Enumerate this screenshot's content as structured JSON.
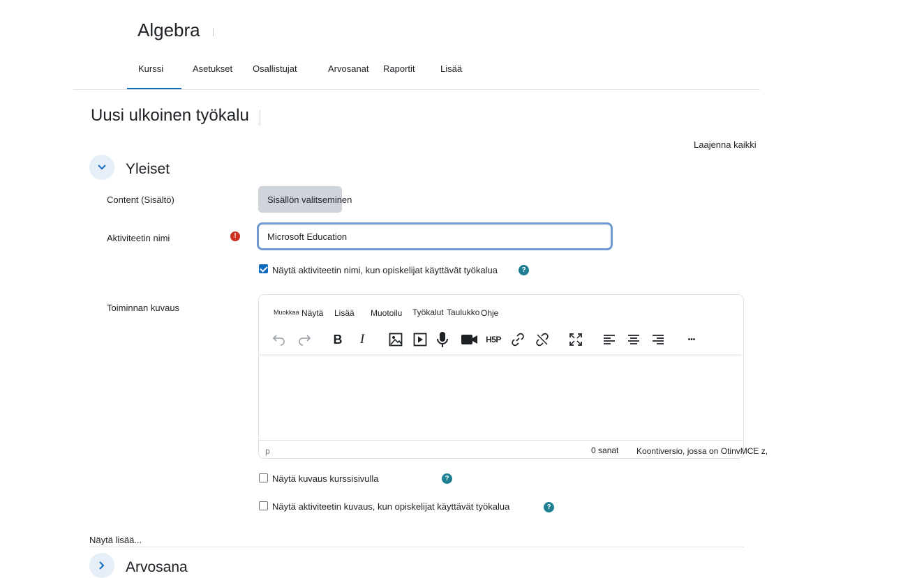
{
  "course": {
    "title": "Algebra"
  },
  "nav": {
    "tabs": [
      {
        "label": "Kurssi"
      },
      {
        "label": "Asetukset"
      },
      {
        "label": "Osallistujat"
      },
      {
        "label": "Arvosanat"
      },
      {
        "label": "Raportit"
      },
      {
        "label": "Lisää"
      }
    ],
    "active_tab": "Kurssi"
  },
  "page": {
    "heading": "Uusi ulkoinen työkalu",
    "expand_all": "Laajenna kaikki"
  },
  "general_section": {
    "title": "Yleiset",
    "content_label": "Content (Sisältö)",
    "select_content_button": "Sisällön valitseminen",
    "activity_name_label": "Aktiviteetin nimi",
    "activity_name_value": "Microsoft Education",
    "show_name_checkbox": "Näytä aktiviteetin nimi, kun opiskelijat käyttävät työkalua",
    "show_name_checked": true,
    "description_label": "Toiminnan kuvaus",
    "show_description_checkbox": "Näytä kuvaus kurssisivulla",
    "show_description_checked": false,
    "show_activity_description_checkbox": "Näytä aktiviteetin kuvaus, kun opiskelijat käyttävät työkalua",
    "show_activity_description_checked": false
  },
  "editor": {
    "menu": [
      "Muokkaa",
      "Näytä",
      "Lisää",
      "Muotoilu",
      "Työkalut",
      "Taulukko",
      "Ohje"
    ],
    "toolbar_icons": [
      "undo-icon",
      "redo-icon",
      "bold-icon",
      "italic-icon",
      "image-icon",
      "media-icon",
      "microphone-icon",
      "video-camera-icon",
      "h5p-icon",
      "link-icon",
      "unlink-icon",
      "fullscreen-icon",
      "align-left-icon",
      "align-center-icon",
      "align-right-icon",
      "more-icon"
    ],
    "bold_glyph": "B",
    "italic_glyph": "I",
    "h5p_glyph": "H5P",
    "more_glyph": "•••",
    "status_path": "p",
    "word_count": "0",
    "word_unit": "sanat",
    "branding": "Koontiversio, jossa on OtinvMCE z,"
  },
  "footer": {
    "show_more": "Näytä lisää...",
    "next_section_title": "Arvosana"
  },
  "colors": {
    "accent": "#0f6cbf",
    "required": "#ca3120",
    "help": "#1f7f92",
    "toggle_bg": "#e6eef7"
  }
}
